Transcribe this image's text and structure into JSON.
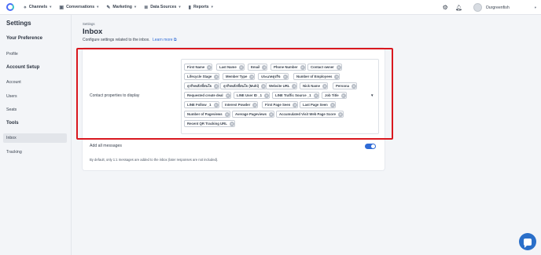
{
  "topnav": {
    "items": [
      {
        "icon": "share-icon",
        "glyph": "⋄",
        "label": "Channels"
      },
      {
        "icon": "chat-icon",
        "glyph": "▣",
        "label": "Conversations"
      },
      {
        "icon": "megaphone-icon",
        "glyph": "✎",
        "label": "Marketing"
      },
      {
        "icon": "database-icon",
        "glyph": "≣",
        "label": "Data Sources"
      },
      {
        "icon": "chart-icon",
        "glyph": "▮",
        "label": "Reports"
      }
    ],
    "user": "Ourgreenfish"
  },
  "sidebar": {
    "title": "Settings",
    "sections": [
      {
        "header": "Your Preference",
        "items": [
          "Profile"
        ]
      },
      {
        "header": "Account Setup",
        "items": [
          "Account",
          "Users",
          "Seats"
        ]
      },
      {
        "header": "Tools",
        "items": [
          "Inbox",
          "Tracking"
        ]
      }
    ],
    "active": "Inbox"
  },
  "page": {
    "breadcrumb": "Settings",
    "title": "Inbox",
    "subtitle": "Configure settings related to the inbox.",
    "learn_more": "Learn more"
  },
  "contact_properties": {
    "label": "Contact properties to display",
    "tags": [
      "First Name",
      "Last Name",
      "Email",
      "Phone Number",
      "Contact owner",
      "Lifecycle Stage",
      "Member Type",
      "ประเภทธุรกิจ",
      "Number of Employees",
      "ธุรกิจหลักที่สนใจ",
      "ธุรกิจหลักที่สนใจ (Multi)",
      "Website URL",
      "Nick Name",
      "Persona",
      "Requested create deal",
      "LINE User ID _1",
      "LINE Traffic Source _1",
      "Job Title",
      "LINE Follow _1",
      "Interest Powder",
      "First Page Seen",
      "Last Page Seen",
      "Number of Pageviews",
      "Average Pageviews",
      "Accumulated Visit Web Page Score",
      "Recent QR Tracking URL"
    ]
  },
  "add_all": {
    "label": "Add all messages",
    "enabled": true,
    "note": "By default, only 1:1 messages are added to the inbox (later responses are not included)."
  },
  "colors": {
    "accent": "#2f6bd6",
    "highlight": "#d9181f"
  }
}
